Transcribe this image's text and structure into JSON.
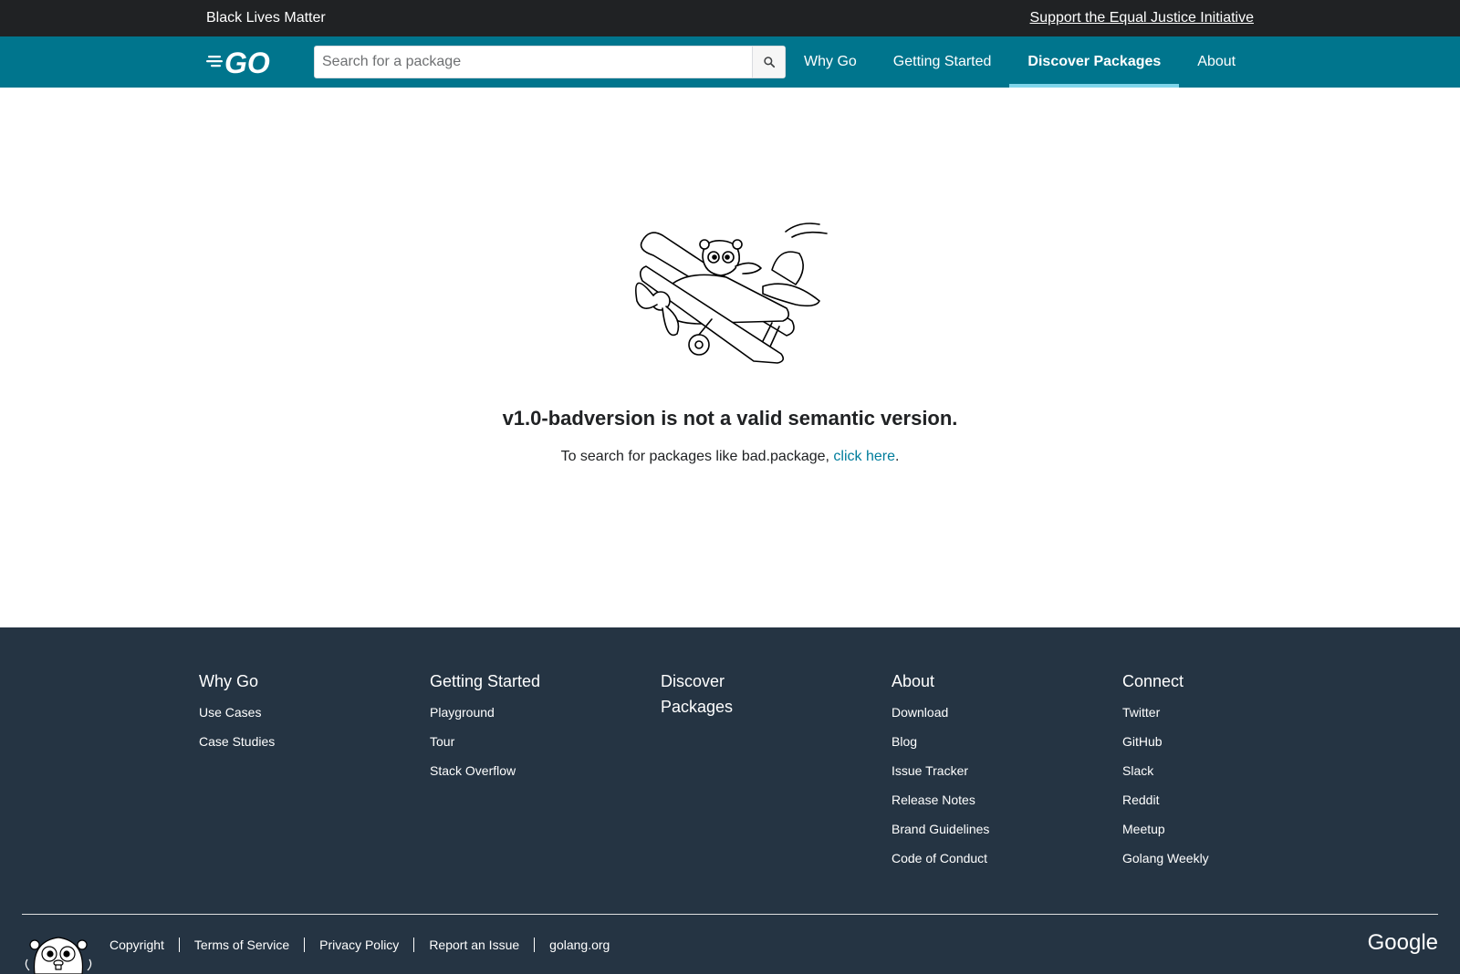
{
  "banner": {
    "left_text": "Black Lives Matter",
    "right_link": "Support the Equal Justice Initiative"
  },
  "header": {
    "logo_text": "GO",
    "search_placeholder": "Search for a package",
    "nav": [
      {
        "label": "Why Go",
        "active": false
      },
      {
        "label": "Getting Started",
        "active": false
      },
      {
        "label": "Discover Packages",
        "active": true
      },
      {
        "label": "About",
        "active": false
      }
    ]
  },
  "main": {
    "error_title": "v1.0-badversion is not a valid semantic version.",
    "error_prefix": "To search for packages like bad.package, ",
    "error_link": "click here",
    "error_suffix": "."
  },
  "footer": {
    "columns": [
      {
        "heading": "Why Go",
        "links": [
          "Use Cases",
          "Case Studies"
        ]
      },
      {
        "heading": "Getting Started",
        "links": [
          "Playground",
          "Tour",
          "Stack Overflow"
        ]
      },
      {
        "heading": "Discover Packages",
        "links": []
      },
      {
        "heading": "About",
        "links": [
          "Download",
          "Blog",
          "Issue Tracker",
          "Release Notes",
          "Brand Guidelines",
          "Code of Conduct"
        ]
      },
      {
        "heading": "Connect",
        "links": [
          "Twitter",
          "GitHub",
          "Slack",
          "Reddit",
          "Meetup",
          "Golang Weekly"
        ]
      }
    ],
    "bottom_links": [
      "Copyright",
      "Terms of Service",
      "Privacy Policy",
      "Report an Issue",
      "golang.org"
    ],
    "google_text": "Google"
  },
  "colors": {
    "banner_bg": "#202224",
    "header_bg": "#00758d",
    "active_underline": "#7fd5ea",
    "link": "#007d9c",
    "footer_bg": "#253443"
  }
}
